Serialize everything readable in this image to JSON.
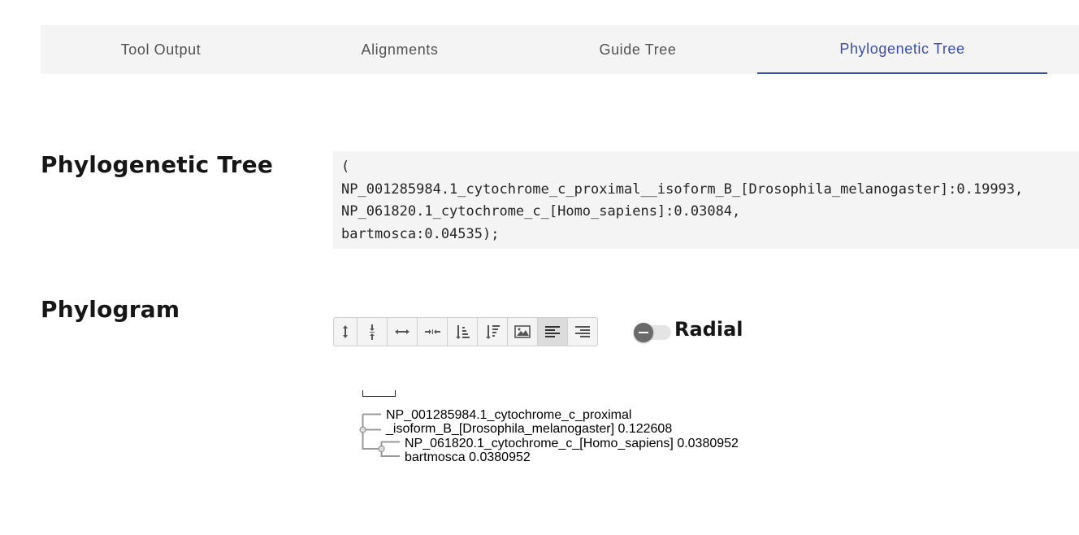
{
  "tabs": [
    {
      "label": "Tool Output"
    },
    {
      "label": "Alignments"
    },
    {
      "label": "Guide Tree"
    },
    {
      "label": "Phylogenetic Tree",
      "active": true
    }
  ],
  "phylogenetic_tree": {
    "title": "Phylogenetic Tree",
    "newick_lines": [
      "(",
      "NP_001285984.1_cytochrome_c_proximal__isoform_B_[Drosophila_melanogaster]:0.19993,",
      "NP_061820.1_cytochrome_c_[Homo_sapiens]:0.03084,",
      "bartmosca:0.04535);"
    ]
  },
  "phylogram": {
    "title": "Phylogram",
    "toolbar": [
      {
        "icon": "expand-vertical-icon"
      },
      {
        "icon": "compress-vertical-icon"
      },
      {
        "icon": "expand-horizontal-icon"
      },
      {
        "icon": "compress-horizontal-icon"
      },
      {
        "icon": "sort-ascending-icon"
      },
      {
        "icon": "sort-descending-icon"
      },
      {
        "icon": "image-icon"
      },
      {
        "icon": "align-left-icon",
        "active": true
      },
      {
        "icon": "align-right-icon"
      }
    ],
    "radial_label": "Radial",
    "radial_on": false,
    "leaves": [
      {
        "line1": "NP_001285984.1_cytochrome_c_proximal",
        "line2": "_isoform_B_[Drosophila_melanogaster] 0.122608"
      },
      {
        "line1": "NP_061820.1_cytochrome_c_[Homo_sapiens] 0.0380952"
      },
      {
        "line1": "bartmosca 0.0380952"
      }
    ]
  }
}
